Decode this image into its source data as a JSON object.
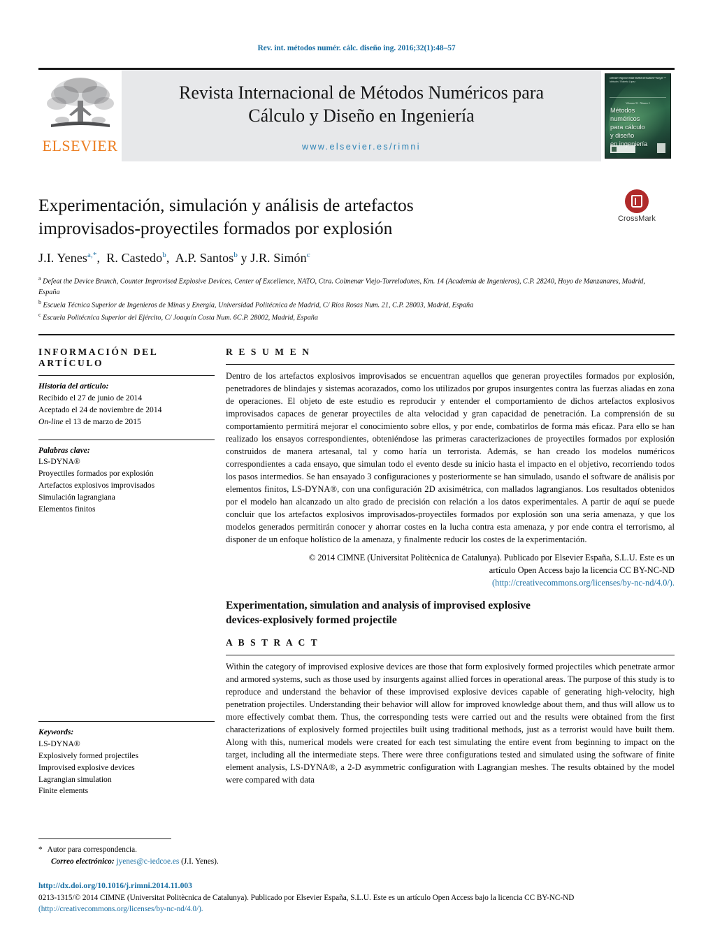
{
  "running_citation": "Rev. int. métodos numér. cálc. diseño ing. 2016;32(1):48–57",
  "masthead": {
    "publisher_wordmark": "ELSEVIER",
    "journal_title_line1": "Revista Internacional de Métodos Numéricos para",
    "journal_title_line2": "Cálculo y Diseño en Ingeniería",
    "journal_url": "www.elsevier.es/rimni",
    "cover": {
      "title_line1": "Métodos",
      "title_line2": "numéricos",
      "title_line3": "para cálculo",
      "title_line4": "y diseño",
      "title_line5": "en ingeniería",
      "top_meta": "Director: Eugenio Oñate Ibáñez de Navarra · Sergio Idelsohn / Roberto López",
      "header_note": "Revista Internacional de Métodos Numéricos 2016",
      "subtitle": "Volumen 32 · Número 1",
      "background_color": "#1f4a3a"
    }
  },
  "article": {
    "title_line1": "Experimentación, simulación y análisis de artefactos",
    "title_line2": "improvisados-proyectiles formados por explosión",
    "crossmark_label": "CrossMark",
    "authors": [
      {
        "name": "J.I. Yenes",
        "marks": "a,*"
      },
      {
        "name": "R. Castedo",
        "marks": "b"
      },
      {
        "name": "A.P. Santos",
        "marks": "b"
      },
      {
        "name": "J.R. Simón",
        "marks": "c",
        "conjunction": "y "
      }
    ],
    "affiliations": [
      {
        "mark": "a",
        "text": "Defeat the Device Branch, Counter Improvised Explosive Devices, Center of Excellence, NATO, Ctra. Colmenar Viejo-Torrelodones, Km. 14 (Academia de Ingenieros), C.P. 28240, Hoyo de Manzanares, Madrid, España"
      },
      {
        "mark": "b",
        "text": "Escuela Técnica Superior de Ingenieros de Minas y Energía, Universidad Politécnica de Madrid, C/ Ríos Rosas Num. 21, C.P. 28003, Madrid, España"
      },
      {
        "mark": "c",
        "text": "Escuela Politécnica Superior del Ejército, C/ Joaquín Costa Num. 6C.P. 28002, Madrid, España"
      }
    ]
  },
  "article_info": {
    "heading": "INFORMACIÓN DEL ARTÍCULO",
    "history_label": "Historia del artículo:",
    "history": [
      {
        "text": "Recibido el 27 de junio de 2014"
      },
      {
        "text": "Aceptado el 24 de noviembre de 2014"
      },
      {
        "italic_prefix": "On-line",
        "text": " el 13 de marzo de 2015"
      }
    ],
    "keywords_label": "Palabras clave:",
    "keywords": [
      "LS-DYNA®",
      "Proyectiles formados por explosión",
      "Artefactos explosivos improvisados",
      "Simulación lagrangiana",
      "Elementos finitos"
    ],
    "keywords_en_label": "Keywords:",
    "keywords_en": [
      "LS-DYNA®",
      "Explosively formed projectiles",
      "Improvised explosive devices",
      "Lagrangian simulation",
      "Finite elements"
    ]
  },
  "resumen": {
    "heading": "R E S U M E N",
    "body": "Dentro de los artefactos explosivos improvisados se encuentran aquellos que generan proyectiles formados por explosión, penetradores de blindajes y sistemas acorazados, como los utilizados por grupos insurgentes contra las fuerzas aliadas en zona de operaciones. El objeto de este estudio es reproducir y entender el comportamiento de dichos artefactos explosivos improvisados capaces de generar proyectiles de alta velocidad y gran capacidad de penetración. La comprensión de su comportamiento permitirá mejorar el conocimiento sobre ellos, y por ende, combatirlos de forma más eficaz. Para ello se han realizado los ensayos correspondientes, obteniéndose las primeras caracterizaciones de proyectiles formados por explosión construidos de manera artesanal, tal y como haría un terrorista. Además, se han creado los modelos numéricos correspondientes a cada ensayo, que simulan todo el evento desde su inicio hasta el impacto en el objetivo, recorriendo todos los pasos intermedios. Se han ensayado 3 configuraciones y posteriormente se han simulado, usando el software de análisis por elementos finitos, LS-DYNA®, con una configuración 2D axisimétrica, con mallados lagrangianos. Los resultados obtenidos por el modelo han alcanzado un alto grado de precisión con relación a los datos experimentales. A partir de aquí se puede concluir que los artefactos explosivos improvisados-proyectiles formados por explosión son una seria amenaza, y que los modelos generados permitirán conocer y ahorrar costes en la lucha contra esta amenaza, y por ende contra el terrorismo, al disponer de un enfoque holístico de la amenaza, y finalmente reducir los costes de la experimentación.",
    "copyright_line1": "© 2014 CIMNE (Universitat Politècnica de Catalunya). Publicado por Elsevier España, S.L.U. Este es un",
    "copyright_line2": "artículo Open Access bajo la licencia CC BY-NC-ND",
    "copyright_link": "(http://creativecommons.org/licenses/by-nc-nd/4.0/)."
  },
  "abstract": {
    "title_line1": "Experimentation, simulation and analysis of improvised explosive",
    "title_line2": "devices-explosively formed projectile",
    "heading": "A B S T R A C T",
    "body": "Within the category of improvised explosive devices are those that form explosively formed projectiles which penetrate armor and armored systems, such as those used by insurgents against allied forces in operational areas. The purpose of this study is to reproduce and understand the behavior of these improvised explosive devices capable of generating high-velocity, high penetration projectiles. Understanding their behavior will allow for improved knowledge about them, and thus will allow us to more effectively combat them. Thus, the corresponding tests were carried out and the results were obtained from the first characterizations of explosively formed projectiles built using traditional methods, just as a terrorist would have built them. Along with this, numerical models were created for each test simulating the entire event from beginning to impact on the target, including all the intermediate steps. There were three configurations tested and simulated using the software of finite element analysis, LS-DYNA®, a 2-D asymmetric configuration with Lagrangian meshes. The results obtained by the model were compared with data"
  },
  "footer": {
    "corresponding_note": "Autor para correspondencia.",
    "email_label": "Correo electrónico:",
    "email": "jyenes@c-iedcoe.es",
    "email_owner": "(J.I. Yenes).",
    "doi": "http://dx.doi.org/10.1016/j.rimni.2014.11.003",
    "issn_line": "0213-1315/© 2014 CIMNE (Universitat Politècnica de Catalunya). Publicado por Elsevier España, S.L.U. Este es un artículo Open Access bajo la licencia CC BY-NC-ND",
    "issn_link": "(http://creativecommons.org/licenses/by-nc-nd/4.0/)."
  }
}
